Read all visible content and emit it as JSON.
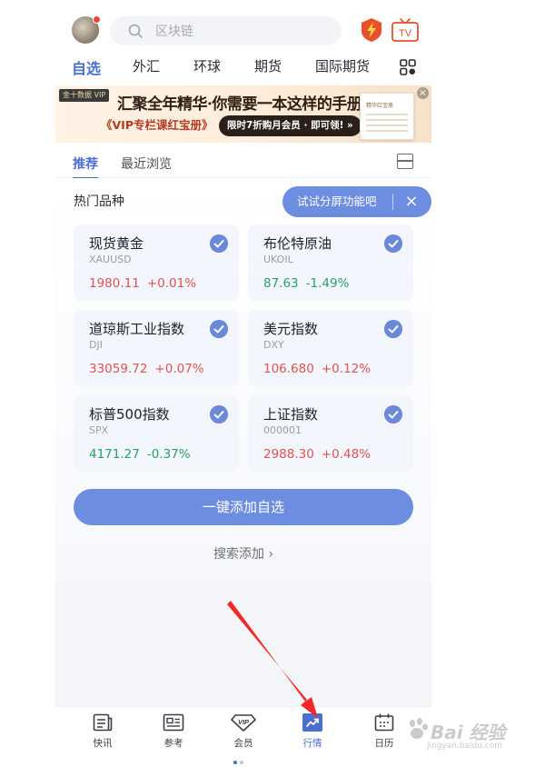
{
  "header": {
    "search_placeholder": "区块链",
    "tv_label": "TV"
  },
  "tabs": [
    {
      "label": "自选",
      "active": true
    },
    {
      "label": "外汇"
    },
    {
      "label": "环球"
    },
    {
      "label": "期货"
    },
    {
      "label": "国际期货"
    }
  ],
  "banner": {
    "badge": "金十数据 VIP",
    "headline": "汇聚全年精华·你需要一本这样的手册!",
    "subline": "《VIP专栏课红宝册》",
    "pill": "限时7折购月会员 · 即可领! »",
    "book_title": "精华红宝册",
    "close": "×"
  },
  "subtabs": [
    {
      "label": "推荐",
      "active": true
    },
    {
      "label": "最近浏览"
    }
  ],
  "hot": {
    "title": "热门品种",
    "tooltip": "试试分屏功能吧",
    "tooltip_close": "×"
  },
  "cards": [
    {
      "name": "现货黄金",
      "code": "XAUUSD",
      "price": "1980.11",
      "change": "+0.01%",
      "direction": "up"
    },
    {
      "name": "布伦特原油",
      "code": "UKOIL",
      "price": "87.63",
      "change": "-1.49%",
      "direction": "down"
    },
    {
      "name": "道琼斯工业指数",
      "code": "DJI",
      "price": "33059.72",
      "change": "+0.07%",
      "direction": "up"
    },
    {
      "name": "美元指数",
      "code": "DXY",
      "price": "106.680",
      "change": "+0.12%",
      "direction": "up"
    },
    {
      "name": "标普500指数",
      "code": "SPX",
      "price": "4171.27",
      "change": "-0.37%",
      "direction": "down"
    },
    {
      "name": "上证指数",
      "code": "000001",
      "price": "2988.30",
      "change": "+0.48%",
      "direction": "up"
    }
  ],
  "actions": {
    "add_all": "一键添加自选",
    "search_add": "搜索添加 ›"
  },
  "bottom_nav": [
    {
      "label": "快讯",
      "icon": "news-icon"
    },
    {
      "label": "参考",
      "icon": "reference-icon"
    },
    {
      "label": "会员",
      "icon": "vip-icon"
    },
    {
      "label": "行情",
      "icon": "market-icon",
      "active": true
    },
    {
      "label": "日历",
      "icon": "calendar-icon"
    }
  ],
  "watermark": {
    "brand": "Bai 经验",
    "url": "jingyan.baidu.com"
  },
  "colors": {
    "accent": "#4a6fd1",
    "button": "#6c8de0",
    "up": "#e05252",
    "down": "#28a06a",
    "arrow": "#f02a2a"
  }
}
